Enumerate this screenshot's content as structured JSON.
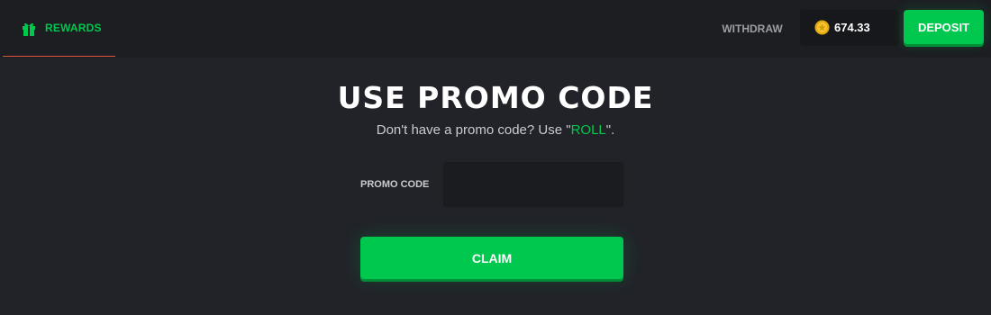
{
  "header": {
    "rewards_tab": {
      "label": "REWARDS",
      "icon": "gift-icon"
    },
    "withdraw_label": "WITHDRAW",
    "balance": {
      "amount": "674.33",
      "icon": "coin-icon"
    },
    "deposit_label": "DEPOSIT"
  },
  "promo": {
    "title": "USE PROMO CODE",
    "subtitle_prefix": "Don't have a promo code? Use \"",
    "subtitle_code": "ROLL",
    "subtitle_suffix": "\".",
    "field_label": "PROMO CODE",
    "field_value": "",
    "claim_label": "CLAIM"
  },
  "colors": {
    "background": "#212329",
    "header_background": "#1c1e22",
    "accent_green": "#00c74d",
    "active_tab_underline": "#e0533e"
  }
}
